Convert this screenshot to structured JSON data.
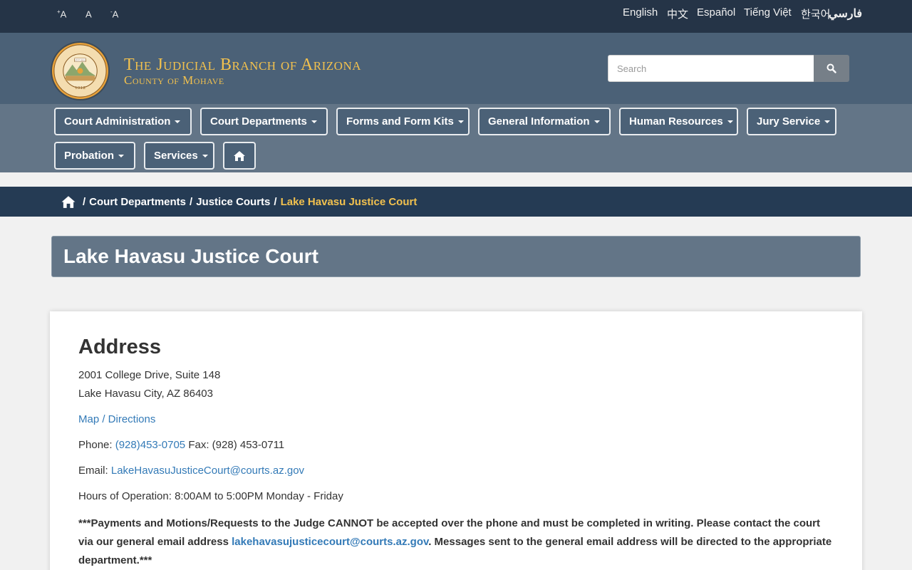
{
  "topbar": {
    "font_sizes": [
      {
        "prefix": "+",
        "label": "A"
      },
      {
        "prefix": "",
        "label": "A"
      },
      {
        "prefix": "-",
        "label": "A"
      }
    ],
    "languages": [
      "English",
      "中文",
      "Español",
      "Tiếng Việt",
      "한국어",
      "فارسي"
    ]
  },
  "header": {
    "seal_icon": "arizona-state-seal-icon",
    "seal_text_top": "GREAT SEAL OF THE STATE OF ARIZONA",
    "seal_motto": "DITAT DEUS",
    "seal_year": "1912",
    "title": "The Judicial Branch of Arizona",
    "subtitle": "County of Mohave",
    "search_placeholder": "Search",
    "title_color": "#f2c14e"
  },
  "nav": {
    "items": [
      "Court Administration",
      "Court Departments",
      "Forms and Form Kits",
      "General Information",
      "Human Resources",
      "Jury Service",
      "Probation",
      "Services"
    ],
    "home_icon": "home-icon"
  },
  "breadcrumb": {
    "home_icon": "home-icon",
    "items": [
      "Court Departments",
      "Justice Courts"
    ],
    "current": "Lake Havasu Justice Court",
    "separator": "/"
  },
  "page": {
    "title": "Lake Havasu Justice Court"
  },
  "content": {
    "heading": "Address",
    "address_line1": "2001 College Drive, Suite 148",
    "address_line2": "Lake Havasu City, AZ 86403",
    "map_link": "Map / Directions",
    "phone_label": "Phone:",
    "phone": "(928)453-0705",
    "fax_label": "Fax:",
    "fax": "(928) 453-0711",
    "email_label": "Email:",
    "email": "LakeHavasuJusticeCourt@courts.az.gov",
    "hours_label": "Hours of Operation:",
    "hours": "8:00AM to 5:00PM Monday - Friday",
    "notice_part1": "***Payments and Motions/Requests to the Judge CANNOT be accepted over the phone and must be completed in writing.  Please contact the court via our general email address ",
    "notice_email": "lakehavasujusticecourt@courts.az.gov",
    "notice_part2": ". Messages sent to the general email address will be directed to the appropriate department.***"
  },
  "colors": {
    "topbar": "#253447",
    "header": "#4b6177",
    "nav": "#637587",
    "breadcrumb": "#253b54",
    "accent": "#f2c14e",
    "link": "#337ab7"
  }
}
